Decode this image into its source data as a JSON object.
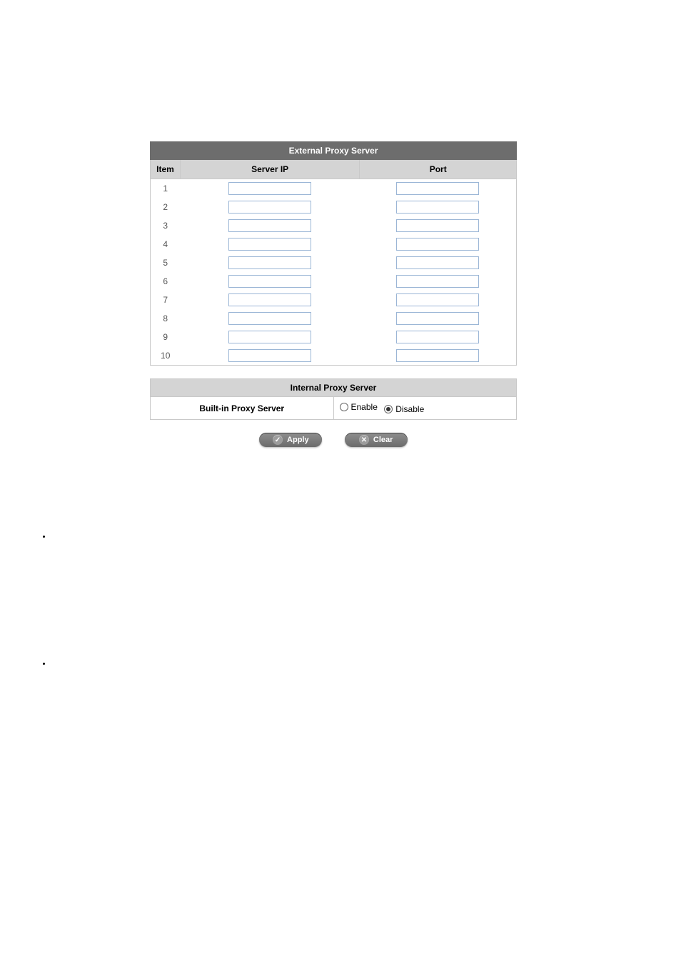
{
  "external_table": {
    "title": "External Proxy Server",
    "headers": {
      "item": "Item",
      "server_ip": "Server IP",
      "port": "Port"
    },
    "rows": [
      {
        "n": "1",
        "ip": "",
        "port": ""
      },
      {
        "n": "2",
        "ip": "",
        "port": ""
      },
      {
        "n": "3",
        "ip": "",
        "port": ""
      },
      {
        "n": "4",
        "ip": "",
        "port": ""
      },
      {
        "n": "5",
        "ip": "",
        "port": ""
      },
      {
        "n": "6",
        "ip": "",
        "port": ""
      },
      {
        "n": "7",
        "ip": "",
        "port": ""
      },
      {
        "n": "8",
        "ip": "",
        "port": ""
      },
      {
        "n": "9",
        "ip": "",
        "port": ""
      },
      {
        "n": "10",
        "ip": "",
        "port": ""
      }
    ]
  },
  "internal_table": {
    "title": "Internal Proxy Server",
    "label": "Built-in Proxy Server",
    "options": {
      "enable": "Enable",
      "disable": "Disable"
    },
    "selected": "disable"
  },
  "buttons": {
    "apply": "Apply",
    "clear": "Clear"
  }
}
